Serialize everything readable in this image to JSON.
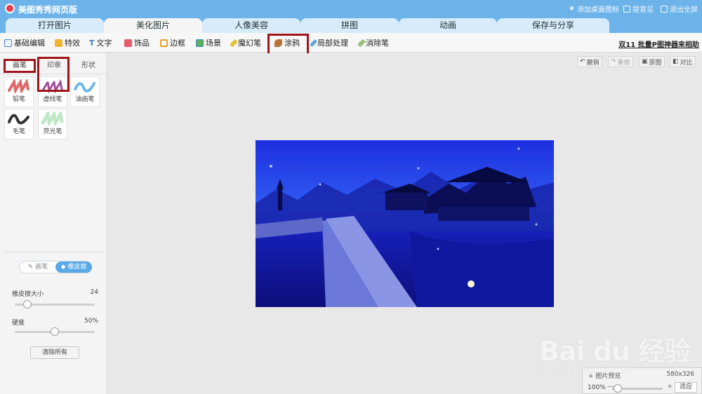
{
  "window": {
    "title": "美图秀秀网页版",
    "links": [
      "添加桌面图标",
      "提意见",
      "退出全屏"
    ]
  },
  "tabs": [
    "打开图片",
    "美化图片",
    "人像美容",
    "拼图",
    "动画",
    "保存与分享"
  ],
  "active_tab": "美化图片",
  "toolbar": {
    "items": [
      "基础编辑",
      "特效",
      "文字",
      "饰品",
      "边框",
      "场景",
      "魔幻笔",
      "涂鸦",
      "局部处理",
      "消除笔"
    ],
    "active": "涂鸦",
    "batch_link": "双11 批量P图神器来相助"
  },
  "left_panel": {
    "subtabs": [
      "画笔",
      "印章",
      "形状"
    ],
    "active_subtab": "画笔",
    "brushes": [
      "铅笔",
      "虚线笔",
      "油画笔",
      "毛笔",
      "荧光笔"
    ],
    "selected_brush": "荧光笔",
    "mode_toggle": [
      "画笔",
      "橡皮擦"
    ],
    "active_mode": "橡皮擦",
    "eraser_size_label": "橡皮擦大小",
    "eraser_size_value": "24",
    "eraser_size_fraction": 0.12,
    "hardness_label": "硬度",
    "hardness_value": "50%",
    "hardness_fraction": 0.5,
    "clear_button": "清除所有"
  },
  "canvas_tools": {
    "undo": "撤销",
    "redo": "重做",
    "original": "原图",
    "compare": "对比"
  },
  "preview": {
    "label": "图片预览",
    "dimensions": "580x326",
    "zoom": "100%",
    "zoom_minus": "—",
    "zoom_plus": "+",
    "fit_button": "适应"
  },
  "watermark": {
    "brand": "Bai du 经验",
    "url": "jingyan.baidu.com"
  }
}
